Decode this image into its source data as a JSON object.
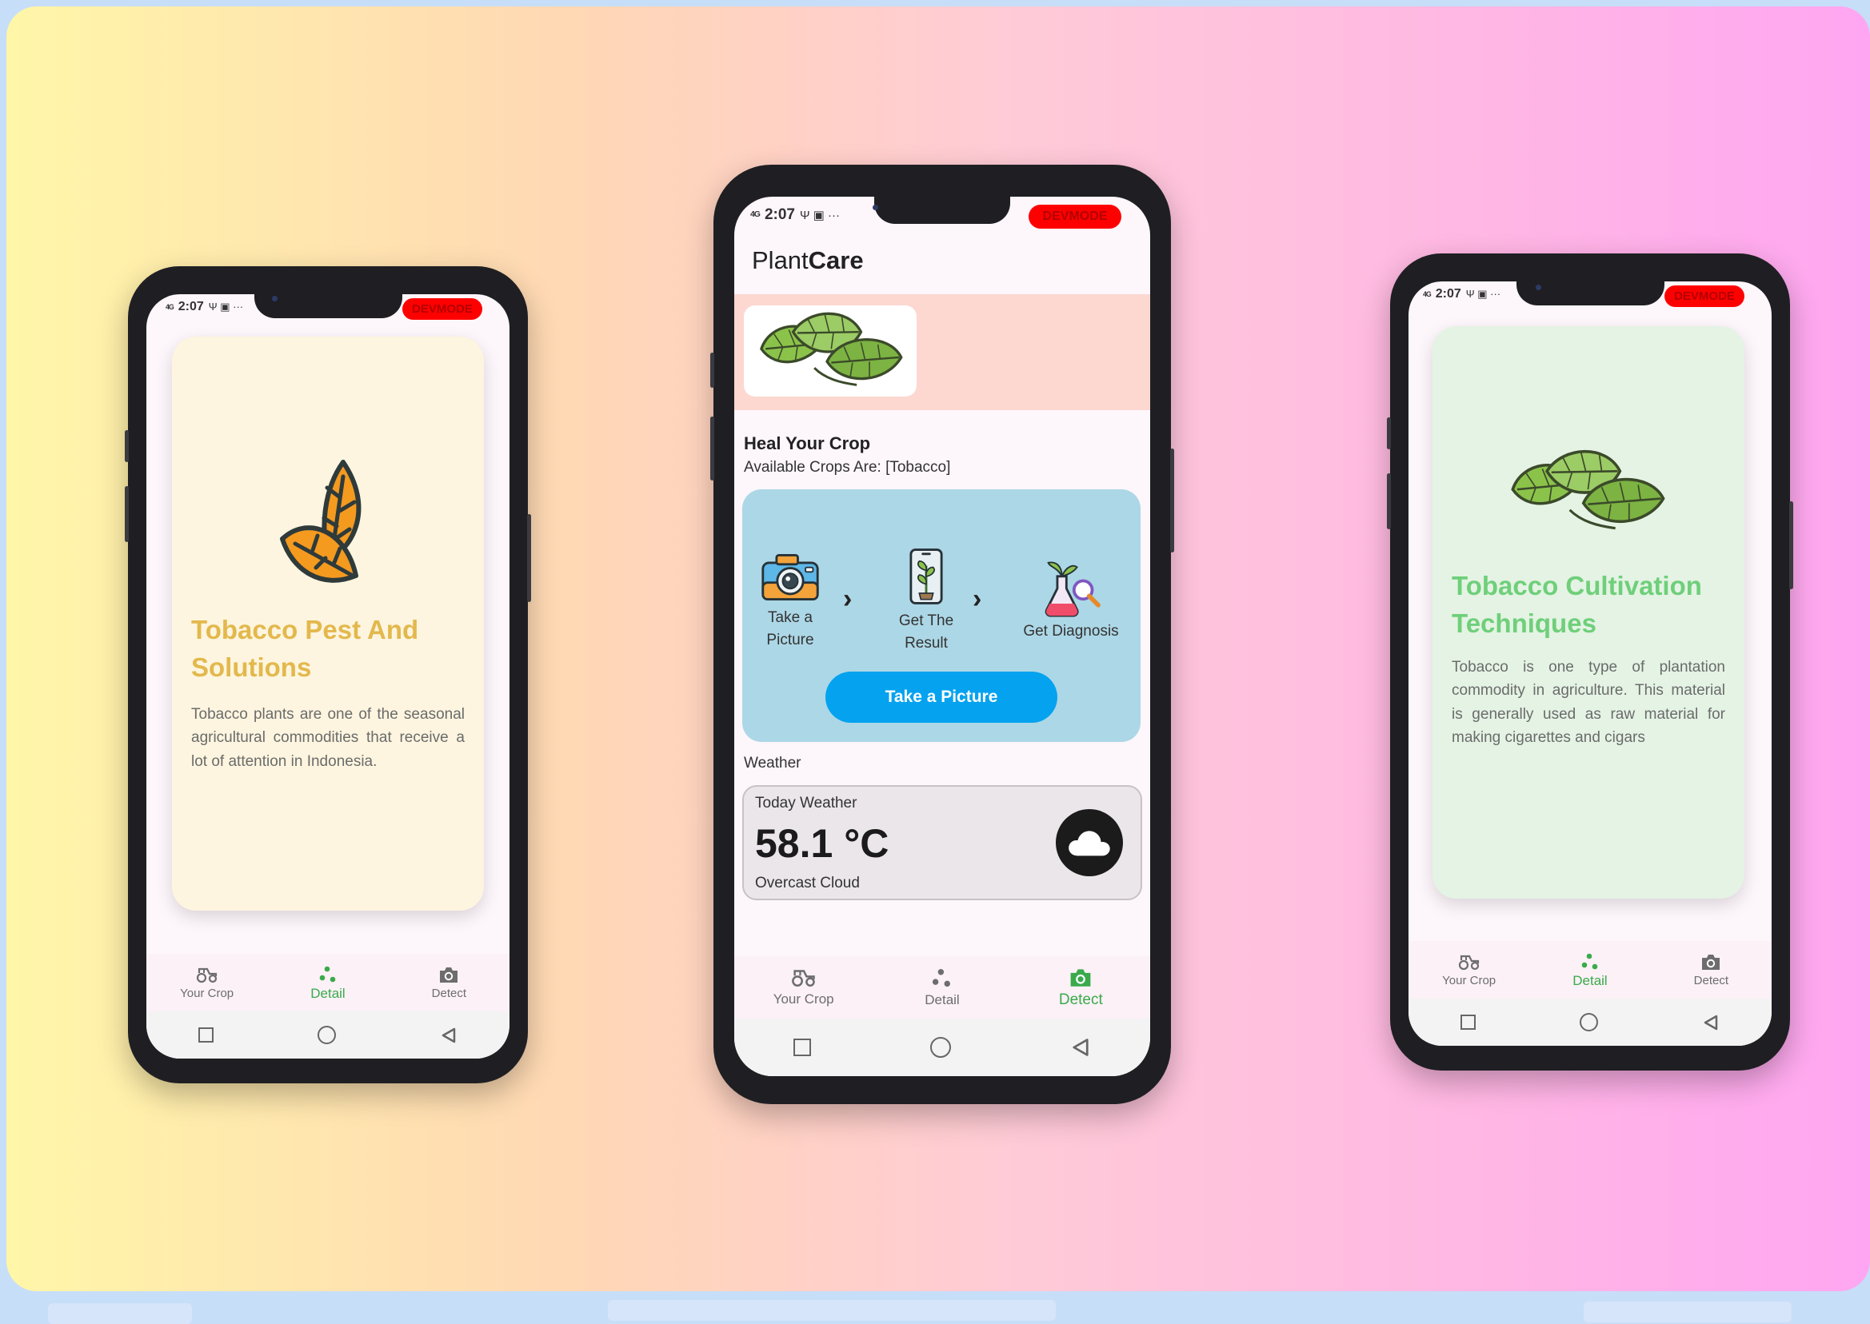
{
  "status": {
    "network": "4G",
    "time": "2:07",
    "extra_icons": "Ψ ▣ ···",
    "devmode_label": "DEVMODE"
  },
  "nav": {
    "items": [
      {
        "label": "Your Crop",
        "icon": "tractor-icon"
      },
      {
        "label": "Detail",
        "icon": "dots-icon"
      },
      {
        "label": "Detect",
        "icon": "camera-icon"
      }
    ]
  },
  "left_phone": {
    "active_tab": "Detail",
    "card": {
      "title": "Tobacco Pest And Solutions",
      "body": "Tobacco plants are one of the seasonal agricultural commodities that receive a lot of attention in Indonesia.",
      "bg_color": "#fdf5df",
      "title_color": "#e3b84c",
      "icon": "orange-leaves-icon"
    }
  },
  "center_phone": {
    "active_tab": "Detect",
    "app_title_regular": "Plant",
    "app_title_bold": "Care",
    "banner_icon": "tobacco-leaves-icon",
    "heal_title": "Heal Your Crop",
    "available_crops": "Available Crops Are: [Tobacco]",
    "steps": [
      {
        "label": "Take a Picture",
        "icon": "camera-color-icon"
      },
      {
        "label": "Get The Result",
        "icon": "phone-plant-icon"
      },
      {
        "label": "Get Diagnosis",
        "icon": "flask-search-icon"
      }
    ],
    "take_picture_button": "Take a Picture",
    "weather_section_label": "Weather",
    "weather": {
      "label": "Today Weather",
      "temperature": "58.1 °C",
      "condition": "Overcast Cloud",
      "icon": "cloud-icon"
    },
    "colors": {
      "accent": "#05a2ef",
      "steps_bg": "#acd7e6",
      "banner_bg": "#fcd8d1",
      "weather_bg": "#ebe6ea"
    }
  },
  "right_phone": {
    "active_tab": "Detail",
    "card": {
      "title": "Tobacco Cultivation Techniques",
      "body": "Tobacco is one type of plantation commodity in agriculture. This material is generally used as raw material for making cigarettes and cigars",
      "bg_color": "#e4f3e4",
      "title_color": "#6fcf7a",
      "icon": "tobacco-leaves-icon"
    }
  },
  "colors": {
    "nav_active": "#3aaa4a",
    "devmode": "#ff0000"
  }
}
